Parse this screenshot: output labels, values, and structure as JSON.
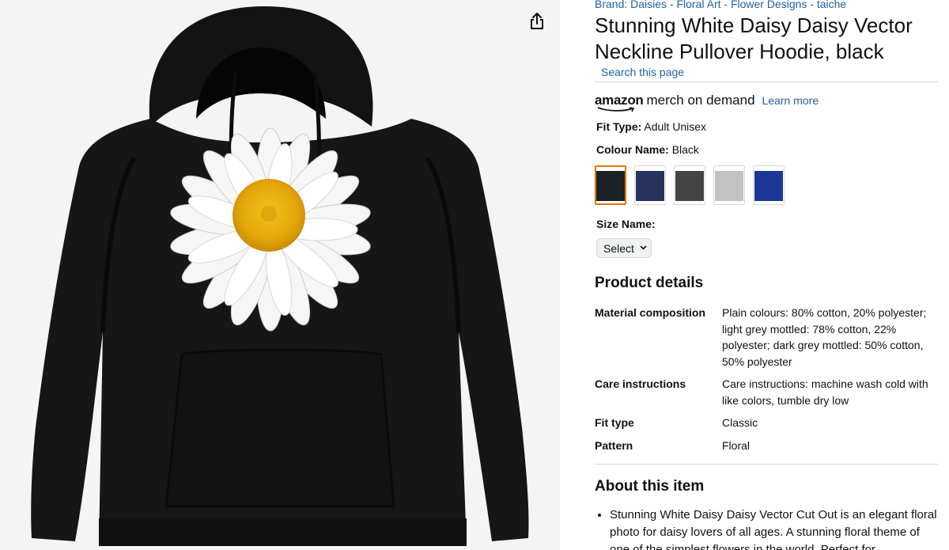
{
  "product": {
    "brand": "Brand: Daisies - Floral Art - Flower Designs - taiche",
    "title": "Stunning White Daisy Daisy Vector Neckline Pullover Hoodie, black",
    "search_page": "Search this page"
  },
  "merch": {
    "amazon": "amazon",
    "label": "merch on demand",
    "learn_more": "Learn more"
  },
  "fit_type": {
    "label": "Fit Type:",
    "value": "Adult Unisex"
  },
  "colour": {
    "label": "Colour Name:",
    "value": "Black",
    "swatches": [
      "#1b2127",
      "#27355e",
      "#444444",
      "#c2c2c2",
      "#1d3796"
    ]
  },
  "size": {
    "label": "Size Name:",
    "select": "Select"
  },
  "details": {
    "heading": "Product details",
    "rows": [
      {
        "key": "Material composition",
        "value": "Plain colours: 80% cotton, 20% polyester; light grey mottled: 78% cotton, 22% polyester; dark grey mottled: 50% cotton, 50% polyester"
      },
      {
        "key": "Care instructions",
        "value": "Care instructions: machine wash cold with like colors, tumble dry low"
      },
      {
        "key": "Fit type",
        "value": "Classic"
      },
      {
        "key": "Pattern",
        "value": "Floral"
      }
    ]
  },
  "about": {
    "heading": "About this item",
    "bullets": [
      "Stunning White Daisy Daisy Vector Cut Out is an elegant floral photo for daisy lovers of all ages. A stunning floral theme of one of the simplest flowers in the world. Perfect for"
    ]
  },
  "icons": {
    "share": "share-icon",
    "chevron": "chevron-down-icon"
  },
  "colors": {
    "link": "#2162a1",
    "selected_border": "#e77600"
  }
}
